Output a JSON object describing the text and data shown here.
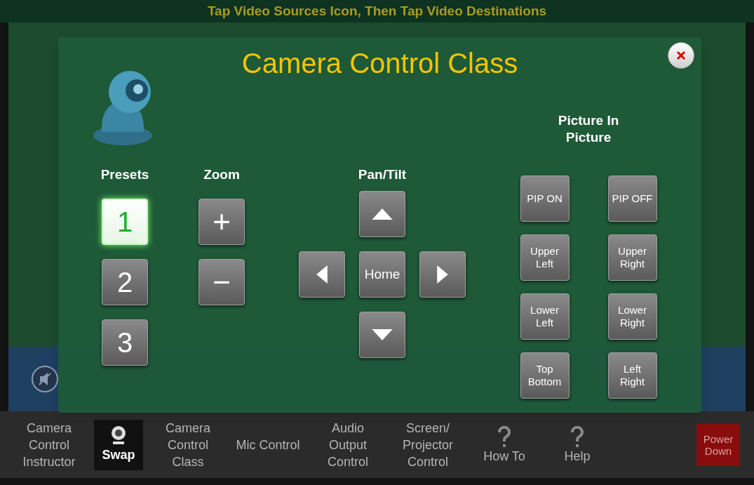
{
  "header": {
    "instruction": "Tap Video Sources Icon, Then Tap Video Destinations"
  },
  "dialog": {
    "title": "Camera Control Class",
    "presets": {
      "label": "Presets",
      "items": [
        {
          "label": "1",
          "selected": true
        },
        {
          "label": "2",
          "selected": false
        },
        {
          "label": "3",
          "selected": false
        }
      ]
    },
    "zoom": {
      "label": "Zoom",
      "buttons": [
        "+",
        "−"
      ]
    },
    "pan_tilt": {
      "label": "Pan/Tilt",
      "center": "Home"
    },
    "pip": {
      "label": "Picture In Picture",
      "buttons": [
        "PIP ON",
        "PIP OFF",
        "Upper Left",
        "Upper Right",
        "Lower Left",
        "Lower Right",
        "Top Bottom",
        "Left Right"
      ]
    }
  },
  "bottom_bar": {
    "items": [
      {
        "label": "Camera Control Instructor",
        "kind": "text"
      },
      {
        "label": "Swap",
        "kind": "swap"
      },
      {
        "label": "Camera Control Class",
        "kind": "text"
      },
      {
        "label": "Mic Control",
        "kind": "text"
      },
      {
        "label": "Audio Output Control",
        "kind": "text"
      },
      {
        "label": "Screen/ Projector Control",
        "kind": "text"
      },
      {
        "label": "How To",
        "kind": "help"
      },
      {
        "label": "Help",
        "kind": "help"
      }
    ],
    "power": "Power Down"
  }
}
